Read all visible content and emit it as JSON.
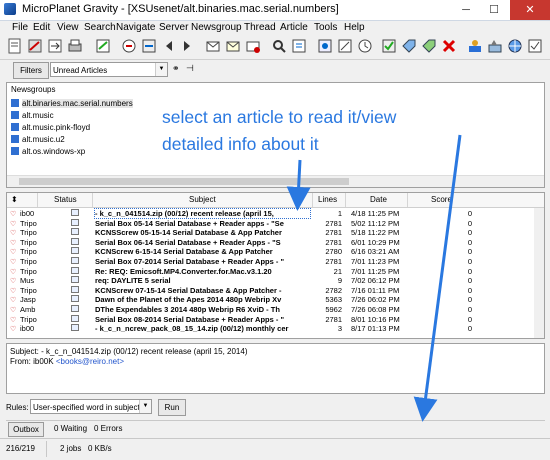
{
  "window": {
    "title": "MicroPlanet Gravity - [XSUsenet/alt.binaries.mac.serial.numbers]",
    "minimize": "─",
    "maximize": "☐",
    "close": "✕"
  },
  "menu": [
    "File",
    "Edit",
    "View",
    "Search",
    "Navigate",
    "Server",
    "Newsgroup",
    "Thread",
    "Article",
    "Tools",
    "Help"
  ],
  "filters": {
    "button": "Filters",
    "selected": "Unread Articles"
  },
  "newsgroups": {
    "header": "Newsgroups",
    "items": [
      "alt.binaries.mac.serial.numbers",
      "alt.music",
      "alt.music.pink-floyd",
      "alt.music.u2",
      "alt.os.windows-xp"
    ]
  },
  "annotation": {
    "line1": "select an article to read it/view",
    "line2": "detailed info about it",
    "color": "#2a78e0"
  },
  "articles": {
    "columns": {
      "status": "Status",
      "subject": "Subject",
      "lines": "Lines",
      "date": "Date",
      "score": "Score"
    },
    "rows": [
      {
        "from": "ib00",
        "subject": "- k_c_n_041514.zip (00/12) recent release (april 15,",
        "lines": "1",
        "date": "4/18 11:25 PM",
        "score": "0"
      },
      {
        "from": "Tripo",
        "subject": "Serial Box 05-14 Serial Database + Reader apps - \"Se",
        "lines": "2781",
        "date": "5/02 11:12 PM",
        "score": "0"
      },
      {
        "from": "Tripo",
        "subject": "KCNSScrew 05-15-14 Serial Database & App Patcher",
        "lines": "2781",
        "date": "5/18 11:22 PM",
        "score": "0"
      },
      {
        "from": "Tripo",
        "subject": "Serial Box 06-14 Serial Database + Reader Apps - \"S",
        "lines": "2781",
        "date": "6/01 10:29 PM",
        "score": "0"
      },
      {
        "from": "Tripo",
        "subject": "KCNScrew 6-15-14 Serial Database & App Patcher",
        "lines": "2780",
        "date": "6/16 03:21 AM",
        "score": "0"
      },
      {
        "from": "Tripo",
        "subject": "Serial Box 07-2014 Serial Database + Reader Apps - \"",
        "lines": "2781",
        "date": "7/01 11:23 PM",
        "score": "0"
      },
      {
        "from": "Tripo",
        "subject": "Re: REQ: Emicsoft.MP4.Converter.for.Mac.v3.1.20",
        "lines": "21",
        "date": "7/01 11:25 PM",
        "score": "0"
      },
      {
        "from": "Mus",
        "subject": "req: DAYLITE 5 serial",
        "lines": "9",
        "date": "7/02 06:12 PM",
        "score": "0"
      },
      {
        "from": "Tripo",
        "subject": "KCNScrew 07-15-14 Serial Database & App Patcher -",
        "lines": "2782",
        "date": "7/16 01:11 PM",
        "score": "0"
      },
      {
        "from": "Jasp",
        "subject": "Dawn of the Planet of the Apes 2014 480p Webrip Xv",
        "lines": "5363",
        "date": "7/26 06:02 PM",
        "score": "0"
      },
      {
        "from": "Amb",
        "subject": "DThe Expendables 3 2014 480p Webrip R6 XviD - Th",
        "lines": "5962",
        "date": "7/26 06:08 PM",
        "score": "0"
      },
      {
        "from": "Tripo",
        "subject": "Serial Box 08-2014 Serial Database + Reader Apps - \"",
        "lines": "2781",
        "date": "8/01 10:16 PM",
        "score": "0"
      },
      {
        "from": "ib00",
        "subject": "- k_c_n_ncrew_pack_08_15_14.zip (00/12) monthly cer",
        "lines": "3",
        "date": "8/17 01:13 PM",
        "score": "0"
      }
    ]
  },
  "body": {
    "subject_label": "Subject:",
    "subject_value": "- k_c_n_041514.zip (00/12) recent release (april 15, 2014)",
    "from_label": "From:",
    "from_name": "ib00K",
    "from_email": "<books@reiro.net>"
  },
  "rules": {
    "label": "Rules:",
    "selected": "User-specified word in subject",
    "run": "Run"
  },
  "outbox": {
    "button": "Outbox",
    "waiting": "0 Waiting",
    "errors": "0 Errors"
  },
  "status": {
    "count": "216/219",
    "jobs": "2 jobs",
    "speed": "0 KB/s"
  },
  "toolbar_icons": [
    "new-article-icon",
    "reply-icon",
    "forward-icon",
    "print-icon",
    "save-icon",
    "goto-icon",
    "next-unread-icon",
    "prev-icon",
    "next-icon",
    "tag-icon",
    "ignore-icon",
    "watch-icon",
    "search-icon",
    "bookmark-icon",
    "view-icon",
    "filter-icon",
    "rules-icon",
    "kill-icon",
    "connect-icon",
    "options-icon",
    "help-icon"
  ]
}
